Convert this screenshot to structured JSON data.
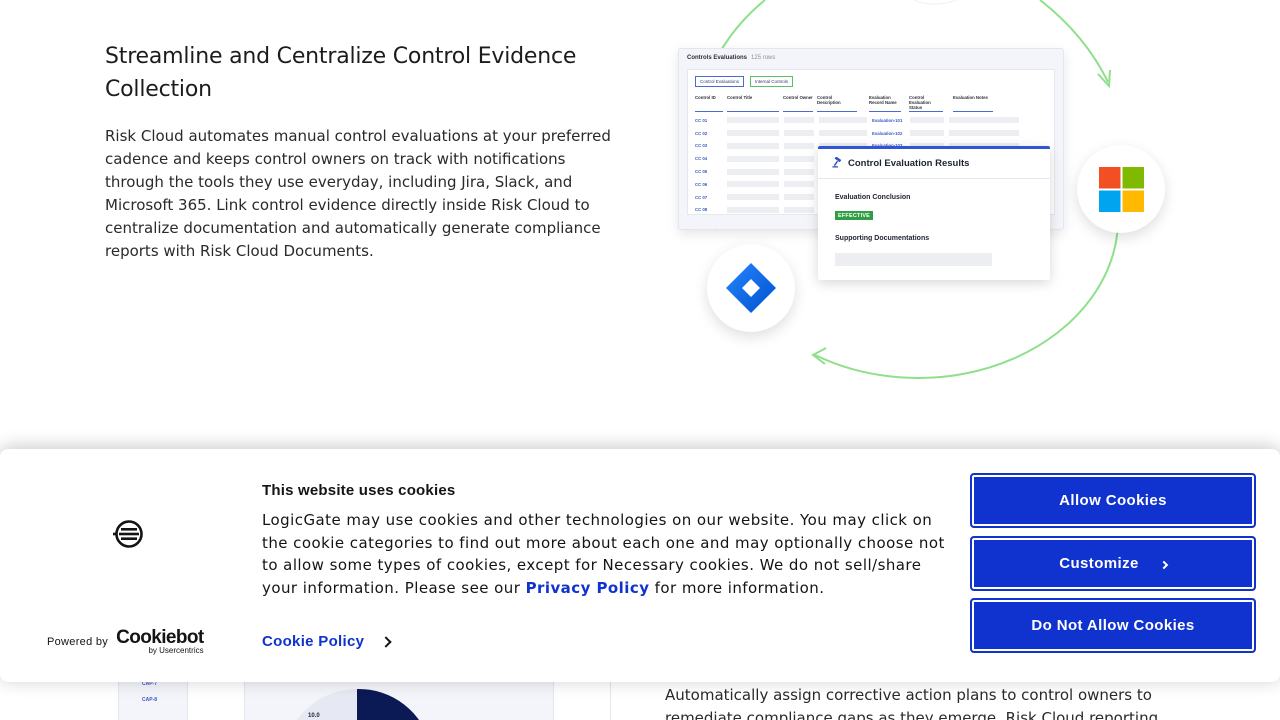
{
  "feature": {
    "title": "Streamline and Centralize Control Evidence Collection",
    "body": "Risk Cloud automates manual control evaluations at your preferred cadence and keeps control owners on track with notifications through the tools they use everyday, including Jira, Slack, and Microsoft 365. Link control evidence directly inside Risk Cloud to centralize documentation and automatically generate compliance reports with Risk Cloud Documents."
  },
  "illustration": {
    "table_title": "Controls Evaluations",
    "table_count": "125 rows",
    "tabs": [
      "Control Evaluations",
      "Internal Controls"
    ],
    "columns": [
      "Control ID",
      "Control Title",
      "Control Owner",
      "Control Description",
      "Evaluation Record Name",
      "Control Evaluation Status",
      "Evaluation Notes"
    ],
    "rows": [
      {
        "id": "CC 01",
        "evaluation": "Evaluation-101"
      },
      {
        "id": "CC 02",
        "evaluation": "Evaluation-102"
      },
      {
        "id": "CC 03",
        "evaluation": "Evaluation-103"
      },
      {
        "id": "CC 04",
        "evaluation": ""
      },
      {
        "id": "CC 05",
        "evaluation": ""
      },
      {
        "id": "CC 06",
        "evaluation": ""
      },
      {
        "id": "CC 07",
        "evaluation": ""
      },
      {
        "id": "CC 08",
        "evaluation": ""
      }
    ],
    "result_title": "Control Evaluation Results",
    "conclusion_label": "Evaluation Conclusion",
    "badge": "EFFECTIVE",
    "supporting_label": "Supporting Documentations",
    "colors": {
      "ring": "#8ee08a",
      "accent": "#2f55d4",
      "badge": "#2f9e44"
    },
    "icons": [
      "jira-icon",
      "microsoft-icon",
      "gavel-icon"
    ]
  },
  "bottom": {
    "mock_labels": [
      "CAP-7",
      "CAP-8"
    ],
    "donut_value": "10.0",
    "text": "Automatically assign corrective action plans to control owners to remediate compliance gaps as they emerge. Risk Cloud reporting"
  },
  "cookie_banner": {
    "title": "This website uses cookies",
    "text_before": "LogicGate may use cookies and other technologies on our website. You may click on the cookie categories to find out more about each one and may optionally choose not to allow some types of cookies, except for Necessary cookies.  We do not sell/share your information. Please see our ",
    "privacy_link": "Privacy Policy",
    "text_after": " for more information.",
    "cookie_policy": "Cookie Policy",
    "powered_by": "Powered by",
    "cookiebot": "Cookiebot",
    "usercentrics": "by Usercentrics",
    "buttons": {
      "allow": "Allow Cookies",
      "customize": "Customize",
      "deny": "Do Not Allow Cookies"
    },
    "colors": {
      "primary": "#1032cf"
    }
  }
}
